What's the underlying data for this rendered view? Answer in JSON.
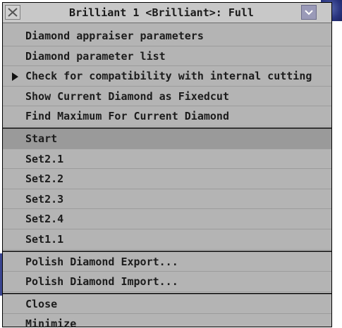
{
  "window": {
    "title": "Brilliant 1 <Brilliant>: Full"
  },
  "menu": {
    "group1": [
      {
        "label": "Diamond appraiser parameters"
      },
      {
        "label": "Diamond parameter list"
      },
      {
        "label": "Check for compatibility with internal cutting",
        "submenu": true
      },
      {
        "label": "Show Current Diamond as Fixedcut"
      },
      {
        "label": "Find Maximum For Current Diamond"
      }
    ],
    "group2": [
      {
        "label": "Start",
        "selected": true
      },
      {
        "label": "Set2.1"
      },
      {
        "label": "Set2.2"
      },
      {
        "label": "Set2.3"
      },
      {
        "label": "Set2.4"
      },
      {
        "label": "Set1.1"
      }
    ],
    "group3": [
      {
        "label": "Polish Diamond Export..."
      },
      {
        "label": "Polish Diamond Import..."
      }
    ],
    "group4": [
      {
        "label": "Close"
      },
      {
        "label": "Minimize"
      }
    ]
  },
  "icons": {
    "close": "close-icon",
    "dropdown": "chevron-down-icon",
    "submenu": "submenu-arrow-icon"
  },
  "colors": {
    "menu_bg": "#b4b4b4",
    "selected_bg": "#9a9a9a",
    "titlebar_bg": "#c8c8c8",
    "text": "#1c1c1c"
  }
}
